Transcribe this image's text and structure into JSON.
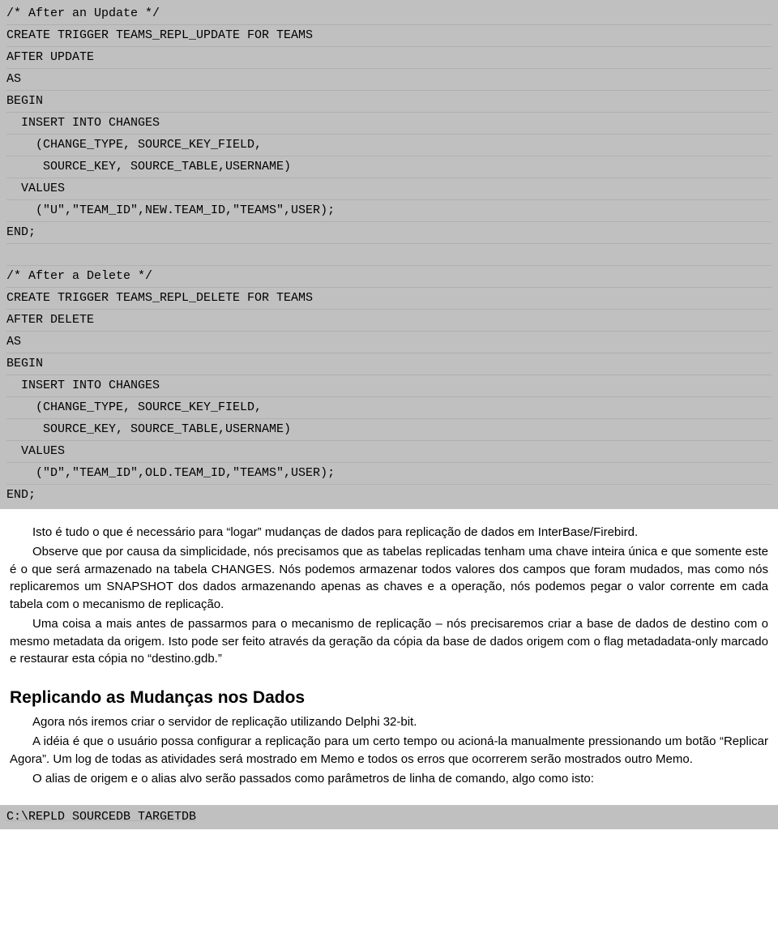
{
  "code1": [
    "/* After an Update */",
    "CREATE TRIGGER TEAMS_REPL_UPDATE FOR TEAMS",
    "AFTER UPDATE",
    "AS",
    "BEGIN",
    "  INSERT INTO CHANGES",
    "    (CHANGE_TYPE, SOURCE_KEY_FIELD,",
    "     SOURCE_KEY, SOURCE_TABLE,USERNAME)",
    "  VALUES",
    "    (\"U\",\"TEAM_ID\",NEW.TEAM_ID,\"TEAMS\",USER);",
    "END;",
    "",
    "/* After a Delete */",
    "CREATE TRIGGER TEAMS_REPL_DELETE FOR TEAMS",
    "AFTER DELETE",
    "AS",
    "BEGIN",
    "  INSERT INTO CHANGES",
    "    (CHANGE_TYPE, SOURCE_KEY_FIELD,",
    "     SOURCE_KEY, SOURCE_TABLE,USERNAME)",
    "  VALUES",
    "    (\"D\",\"TEAM_ID\",OLD.TEAM_ID,\"TEAMS\",USER);",
    "END;"
  ],
  "para1": "Isto é tudo o que é necessário para “logar” mudanças de dados para replicação de dados em InterBase/Firebird.",
  "para2": "Observe que por causa da simplicidade, nós precisamos que as tabelas replicadas tenham uma chave inteira única e que somente este é o que será armazenado na tabela CHANGES. Nós podemos armazenar todos valores dos campos que foram mudados, mas como nós replicaremos um SNAPSHOT dos dados armazenando apenas as chaves e a operação, nós podemos pegar o valor corrente em cada tabela com o mecanismo de replicação.",
  "para3": "Uma coisa a mais antes de passarmos para o mecanismo de replicação – nós precisaremos criar a base de dados de destino com o mesmo metadata da origem. Isto pode ser feito através da geração da cópia da base de dados origem com o flag metadadata-only marcado e restaurar esta cópia no “destino.gdb.”",
  "heading": "Replicando as Mudanças nos Dados",
  "para4": "Agora nós iremos criar o servidor de replicação utilizando Delphi 32-bit.",
  "para5": "A idéia é que o usuário possa configurar a replicação para um certo tempo ou acioná-la manualmente pressionando um botão “Replicar Agora”. Um log de todas as atividades será mostrado em Memo e todos os erros que ocorrerem serão mostrados outro Memo.",
  "para6": "O alias de origem e o alias alvo serão passados como parâmetros de linha de comando, algo como isto:",
  "cmd": "C:\\REPLD SOURCEDB TARGETDB"
}
